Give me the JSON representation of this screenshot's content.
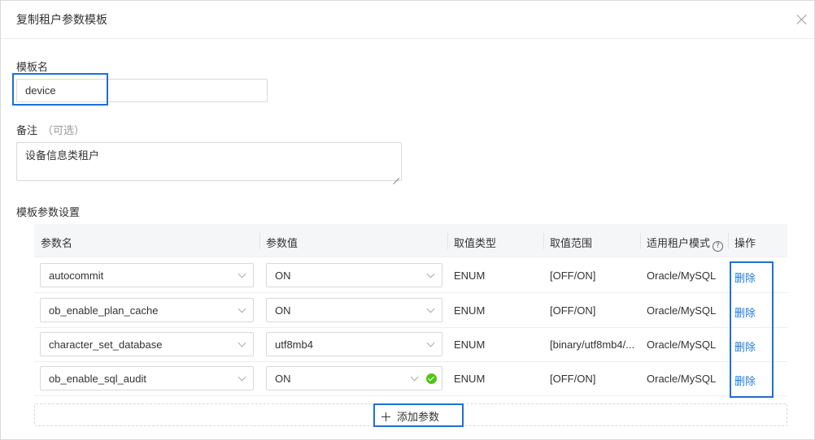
{
  "dialog": {
    "title": "复制租户参数模板"
  },
  "form": {
    "template_name": {
      "label": "模板名",
      "value": "device"
    },
    "remark": {
      "label": "备注",
      "optional_hint": "（可选）",
      "value": "设备信息类租户"
    },
    "params_section_label": "模板参数设置"
  },
  "table": {
    "columns": [
      "参数名",
      "参数值",
      "取值类型",
      "取值范围",
      "适用租户模式",
      "操作"
    ],
    "rows": [
      {
        "name": "autocommit",
        "value": "ON",
        "type": "ENUM",
        "range": "[OFF/ON]",
        "mode": "Oracle/MySQL",
        "action": "删除",
        "validated": false
      },
      {
        "name": "ob_enable_plan_cache",
        "value": "ON",
        "type": "ENUM",
        "range": "[OFF/ON]",
        "mode": "Oracle/MySQL",
        "action": "删除",
        "validated": false
      },
      {
        "name": "character_set_database",
        "value": "utf8mb4",
        "type": "ENUM",
        "range": "[binary/utf8mb4/...",
        "mode": "Oracle/MySQL",
        "action": "删除",
        "validated": false
      },
      {
        "name": "ob_enable_sql_audit",
        "value": "ON",
        "type": "ENUM",
        "range": "[OFF/ON]",
        "mode": "Oracle/MySQL",
        "action": "删除",
        "validated": true
      }
    ]
  },
  "add_button": {
    "label": "添加参数"
  },
  "icons": {
    "close": "close-icon",
    "help": "question-circle-icon",
    "dropdown": "chevron-down-icon",
    "valid": "check-circle-icon",
    "add": "plus-icon"
  },
  "colors": {
    "highlight": "#1f6fd6",
    "link": "#1e7be0",
    "success": "#52c41a"
  }
}
